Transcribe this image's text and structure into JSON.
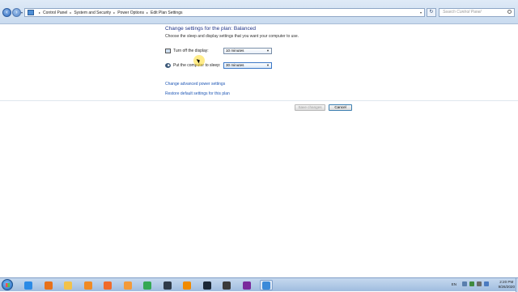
{
  "address_bar": {
    "breadcrumbs": [
      "Control Panel",
      "System and Security",
      "Power Options",
      "Edit Plan Settings"
    ],
    "search_placeholder": "Search Control Panel"
  },
  "page": {
    "title": "Change settings for the plan: Balanced",
    "subtitle": "Choose the sleep and display settings that you want your computer to use.",
    "settings": [
      {
        "label": "Turn off the display:",
        "value": "10 minutes",
        "icon": "monitor-icon"
      },
      {
        "label": "Put the computer to sleep:",
        "value": "30 minutes",
        "icon": "sleep-moon-icon"
      }
    ],
    "links": {
      "advanced": "Change advanced power settings",
      "restore": "Restore default settings for this plan"
    },
    "buttons": {
      "save": "Save changes",
      "cancel": "Cancel"
    }
  },
  "taskbar": {
    "apps": [
      {
        "name": "internet-explorer-icon",
        "color": "#2b8ae6"
      },
      {
        "name": "firefox-icon",
        "color": "#e8711a"
      },
      {
        "name": "file-explorer-icon",
        "color": "#f2c24a"
      },
      {
        "name": "media-player-icon",
        "color": "#f08a24"
      },
      {
        "name": "app-orange-icon",
        "color": "#f06a2a"
      },
      {
        "name": "chat-app-icon",
        "color": "#f39a3a"
      },
      {
        "name": "chrome-icon",
        "color": "#34a853"
      },
      {
        "name": "terminal-icon",
        "color": "#2f3b4a"
      },
      {
        "name": "vlc-icon",
        "color": "#f08a00"
      },
      {
        "name": "steam-icon",
        "color": "#1b2838"
      },
      {
        "name": "obs-icon",
        "color": "#3a3a3a"
      },
      {
        "name": "onenote-icon",
        "color": "#7a2a9c"
      },
      {
        "name": "control-panel-icon",
        "color": "#3b8ad9"
      }
    ],
    "language": "EN",
    "time": "2:20 PM",
    "date": "9/26/2020"
  }
}
